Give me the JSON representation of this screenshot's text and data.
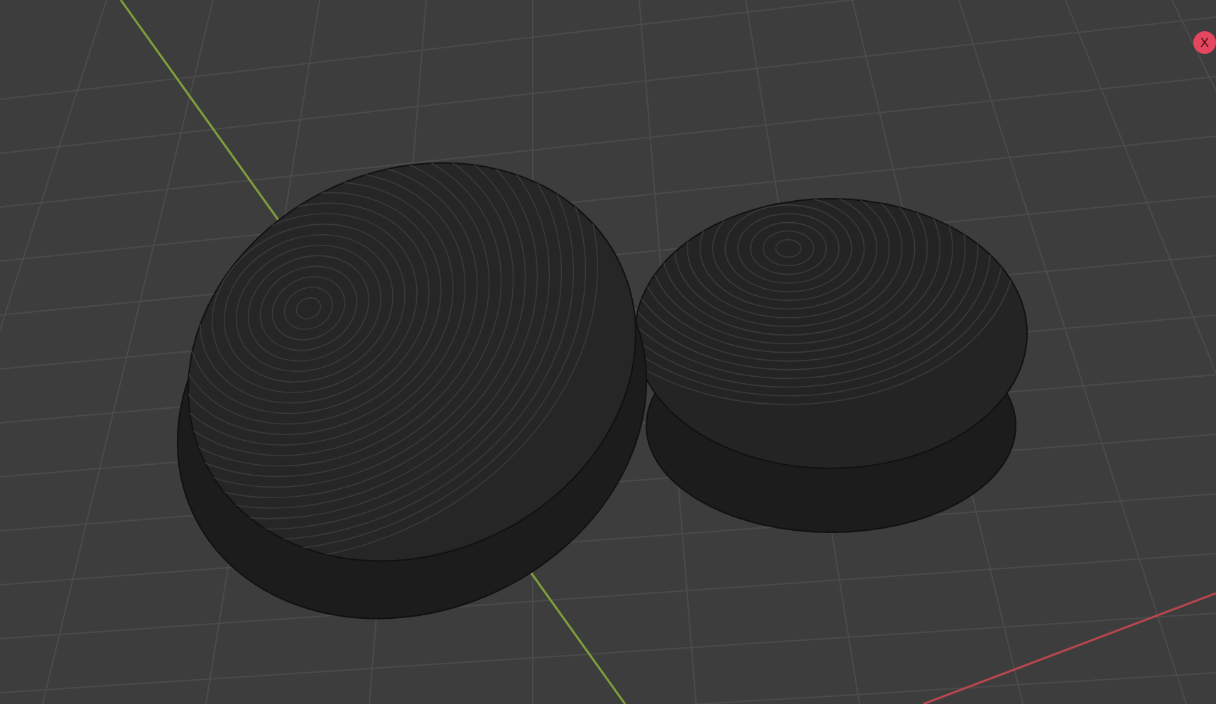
{
  "viewport": {
    "axis_gizmo": {
      "label": "X"
    }
  }
}
